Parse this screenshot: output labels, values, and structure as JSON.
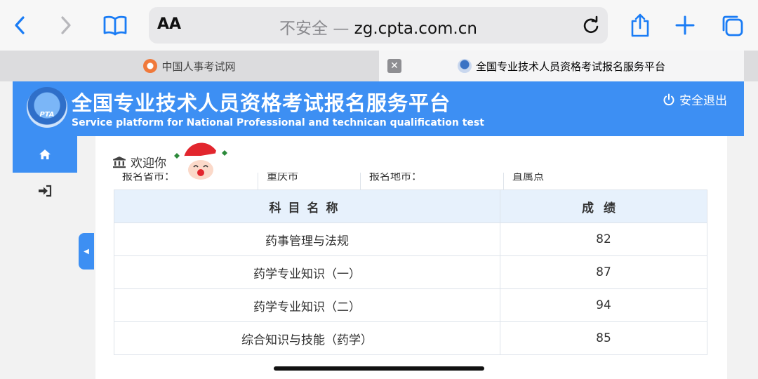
{
  "browser": {
    "text_size_label": "AA",
    "address": {
      "security": "不安全 —",
      "domain": "zg.cpta.com.cn"
    },
    "icons": {
      "back": "chevron-left-icon",
      "forward": "chevron-right-icon",
      "bookmarks": "book-icon",
      "reload": "reload-icon",
      "share": "share-icon",
      "new_tab": "plus-icon",
      "tabs": "tabs-icon"
    },
    "tabs": [
      {
        "title": "中国人事考试网",
        "active": false
      },
      {
        "title": "全国专业技术人员资格考试报名服务平台",
        "active": true
      }
    ]
  },
  "site": {
    "logo_text": "PTA",
    "title": "全国专业技术人员资格考试报名服务平台",
    "subtitle": "Service platform for National Professional and technican qualification test",
    "logout_label": "安全退出",
    "welcome": "欢迎你",
    "accent_color": "#3d8ff3",
    "sidebar": [
      {
        "icon": "home-icon"
      },
      {
        "icon": "sign-in-icon"
      }
    ]
  },
  "info_row": [
    "报名省市：",
    "重庆市",
    "报名地市：",
    "直属点"
  ],
  "scores": {
    "headers": {
      "subject": "科目名称",
      "score": "成绩"
    },
    "rows": [
      {
        "subject": "药事管理与法规",
        "score": "82"
      },
      {
        "subject": "药学专业知识（一）",
        "score": "87"
      },
      {
        "subject": "药学专业知识（二）",
        "score": "94"
      },
      {
        "subject": "综合知识与技能（药学）",
        "score": "85"
      }
    ]
  }
}
